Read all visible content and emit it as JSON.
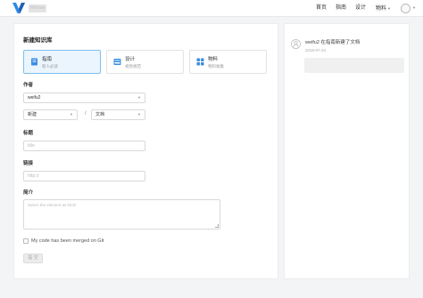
{
  "header": {
    "brand": "Weisue",
    "nav": [
      "首页",
      "指南",
      "设计",
      "物料"
    ],
    "nav_dropdown_index": 3
  },
  "form": {
    "title": "新建知识库",
    "types": [
      {
        "title": "指南",
        "desc": "新人必读",
        "icon": "book-icon",
        "icon_color": "#3b8de0",
        "selected": true
      },
      {
        "title": "设计",
        "desc": "视觉规范",
        "icon": "image-icon",
        "icon_color": "#3b8de0",
        "selected": false
      },
      {
        "title": "物料",
        "desc": "物料收集",
        "icon": "grid-icon",
        "icon_color": "#3b8de0",
        "selected": false
      }
    ],
    "author_label": "作者",
    "author_value": "weifu2",
    "category_value": "新建",
    "doc_type_value": "文档",
    "separator": "/",
    "title_label": "标题",
    "title_placeholder": "title",
    "link_label": "链接",
    "link_placeholder": "http://",
    "intro_label": "简介",
    "intro_placeholder": "Select the element as html!",
    "checkbox_label": "My code has been merged on Git",
    "submit_label": "提 交"
  },
  "feed": {
    "user": "weifu2",
    "action": " 在指南新建了文档",
    "date": "2018-07-23"
  },
  "colors": {
    "accent": "#3b8de0",
    "active_card_bg": "#eaf5fd",
    "active_card_border": "#7fc1ef"
  }
}
